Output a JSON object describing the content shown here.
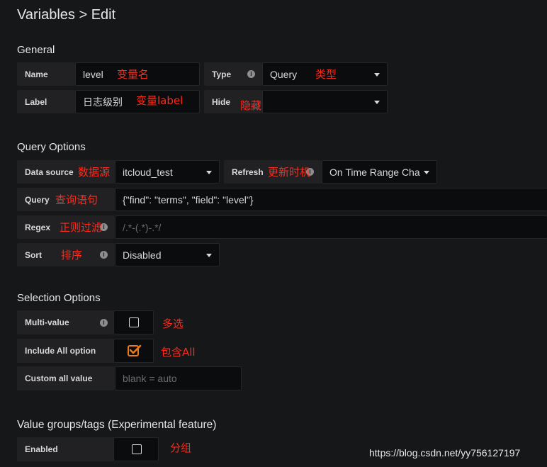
{
  "header": {
    "title": "Variables > Edit"
  },
  "general": {
    "section": "General",
    "name_label": "Name",
    "name_value": "level",
    "name_anno": "变量名",
    "type_label": "Type",
    "type_value": "Query",
    "type_anno": "类型",
    "label_label": "Label",
    "label_value": "日志级别",
    "label_anno": "变量label",
    "hide_label": "Hide",
    "hide_value": "",
    "hide_anno": "隐藏"
  },
  "query_options": {
    "section": "Query Options",
    "datasource_label": "Data source",
    "datasource_anno": "数据源",
    "datasource_value": "itcloud_test",
    "refresh_label": "Refresh",
    "refresh_anno": "更新时机",
    "refresh_value": "On Time Range Cha",
    "query_label": "Query",
    "query_anno": "查询语句",
    "query_value": "{\"find\": \"terms\", \"field\": \"level\"}",
    "regex_label": "Regex",
    "regex_anno": "正则过滤",
    "regex_placeholder": "/.*-(.*)-.*/",
    "sort_label": "Sort",
    "sort_anno": "排序",
    "sort_value": "Disabled"
  },
  "selection_options": {
    "section": "Selection Options",
    "multi_label": "Multi-value",
    "multi_checked": false,
    "multi_anno": "多选",
    "includeall_label": "Include All option",
    "includeall_checked": true,
    "includeall_anno": "包含All",
    "customall_label": "Custom all value",
    "customall_placeholder": "blank = auto"
  },
  "value_groups": {
    "section": "Value groups/tags (Experimental feature)",
    "enabled_label": "Enabled",
    "enabled_checked": false,
    "enabled_anno": "分组"
  },
  "watermark": "https://blog.csdn.net/yy756127197",
  "colors": {
    "accent": "#eb7b18",
    "annotation": "#ff2a1a",
    "background": "#161719"
  }
}
